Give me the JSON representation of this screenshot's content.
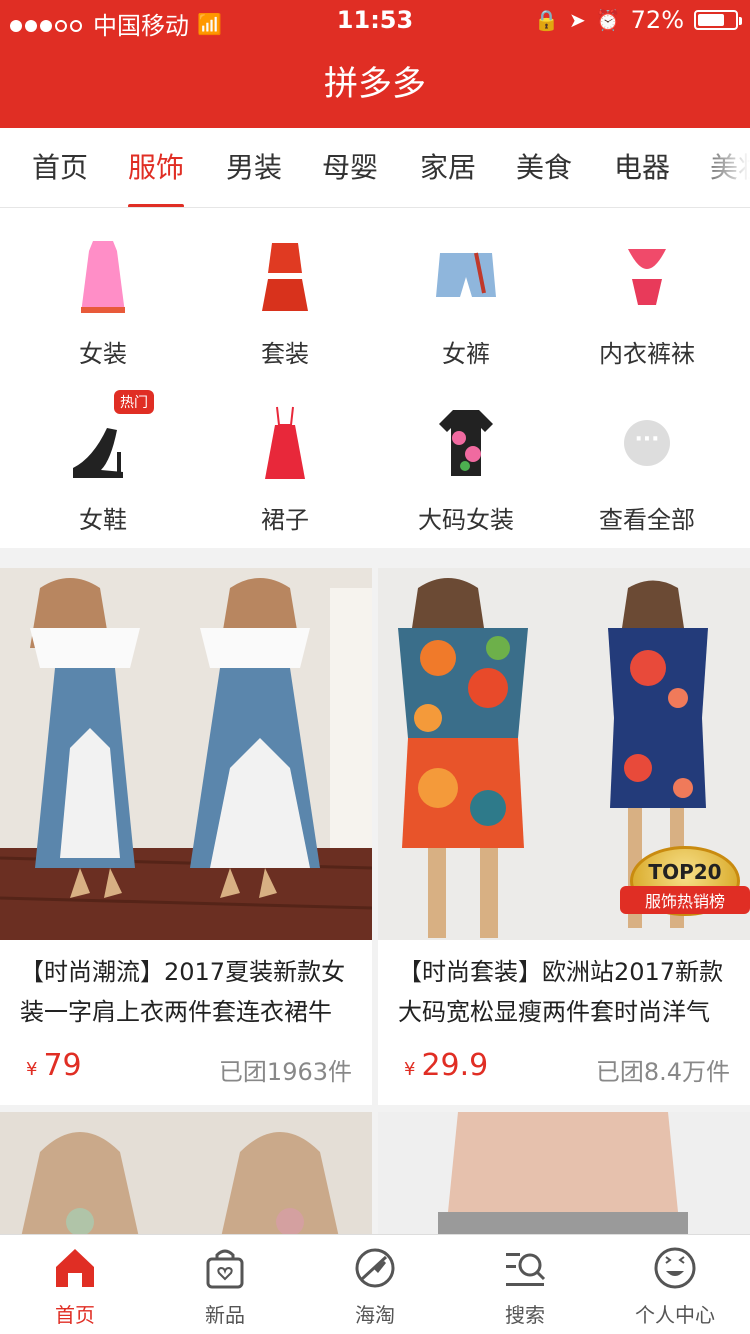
{
  "status": {
    "carrier": "中国移动",
    "time": "11:53",
    "battery": "72%",
    "battery_level": 0.72
  },
  "app_title": "拼多多",
  "tabs": [
    "首页",
    "服饰",
    "男装",
    "母婴",
    "家居",
    "美食",
    "电器",
    "美妆"
  ],
  "categories": [
    {
      "label": "女装",
      "icon": "dress-icon"
    },
    {
      "label": "套装",
      "icon": "two-piece-icon"
    },
    {
      "label": "女裤",
      "icon": "shorts-icon"
    },
    {
      "label": "内衣裤袜",
      "icon": "lingerie-icon"
    },
    {
      "label": "女鞋",
      "icon": "heel-icon",
      "badge": "热门"
    },
    {
      "label": "裙子",
      "icon": "slip-dress-icon"
    },
    {
      "label": "大码女装",
      "icon": "floral-shirt-icon"
    },
    {
      "label": "查看全部",
      "icon": "more-icon"
    }
  ],
  "products": [
    {
      "title": "【时尚潮流】2017夏装新款女装一字肩上衣两件套连衣裙牛",
      "price": "79",
      "currency": "¥",
      "sold": "已团1963件"
    },
    {
      "title": "【时尚套装】欧洲站2017新款大码宽松显瘦两件套时尚洋气",
      "price": "29.9",
      "currency": "¥",
      "sold": "已团8.4万件",
      "badge_top": "TOP20",
      "badge_sub": "服饰热销榜"
    }
  ],
  "tabbar": [
    {
      "label": "首页",
      "icon": "home-icon",
      "active": true
    },
    {
      "label": "新品",
      "icon": "bag-icon",
      "active": false
    },
    {
      "label": "海淘",
      "icon": "globe-plane-icon",
      "active": false
    },
    {
      "label": "搜索",
      "icon": "search-icon",
      "active": false
    },
    {
      "label": "个人中心",
      "icon": "smile-icon",
      "active": false
    }
  ],
  "colors": {
    "accent": "#e02e24"
  }
}
